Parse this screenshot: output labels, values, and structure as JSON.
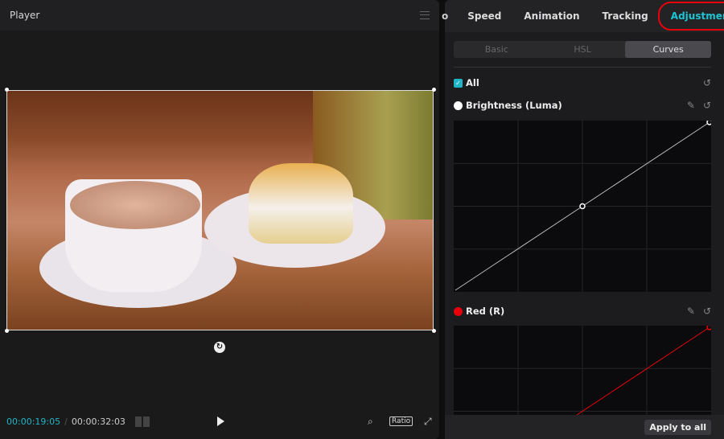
{
  "player": {
    "title": "Player",
    "current_time": "00:00:19:05",
    "separator": "/",
    "total_time": "00:00:32:03",
    "ratio_label": "Ratio"
  },
  "tabs": [
    {
      "label": "Speed"
    },
    {
      "label": "Animation"
    },
    {
      "label": "Tracking"
    },
    {
      "label": "Adjustment",
      "active": true
    }
  ],
  "subtabs": [
    {
      "label": "Basic"
    },
    {
      "label": "HSL"
    },
    {
      "label": "Curves",
      "active": true
    }
  ],
  "curves": {
    "all_label": "All",
    "all_checked": true,
    "brightness": {
      "label": "Brightness (Luma)",
      "color": "#ffffff",
      "points": [
        [
          0,
          0
        ],
        [
          0.5,
          0.5
        ],
        [
          1,
          1
        ]
      ]
    },
    "red": {
      "label": "Red (R)",
      "color": "#e8000a",
      "points": [
        [
          0,
          0
        ],
        [
          1,
          1
        ]
      ]
    }
  },
  "apply_label": "Apply to all",
  "colors": {
    "accent": "#1fc4d4",
    "highlight": "#e8000a"
  }
}
